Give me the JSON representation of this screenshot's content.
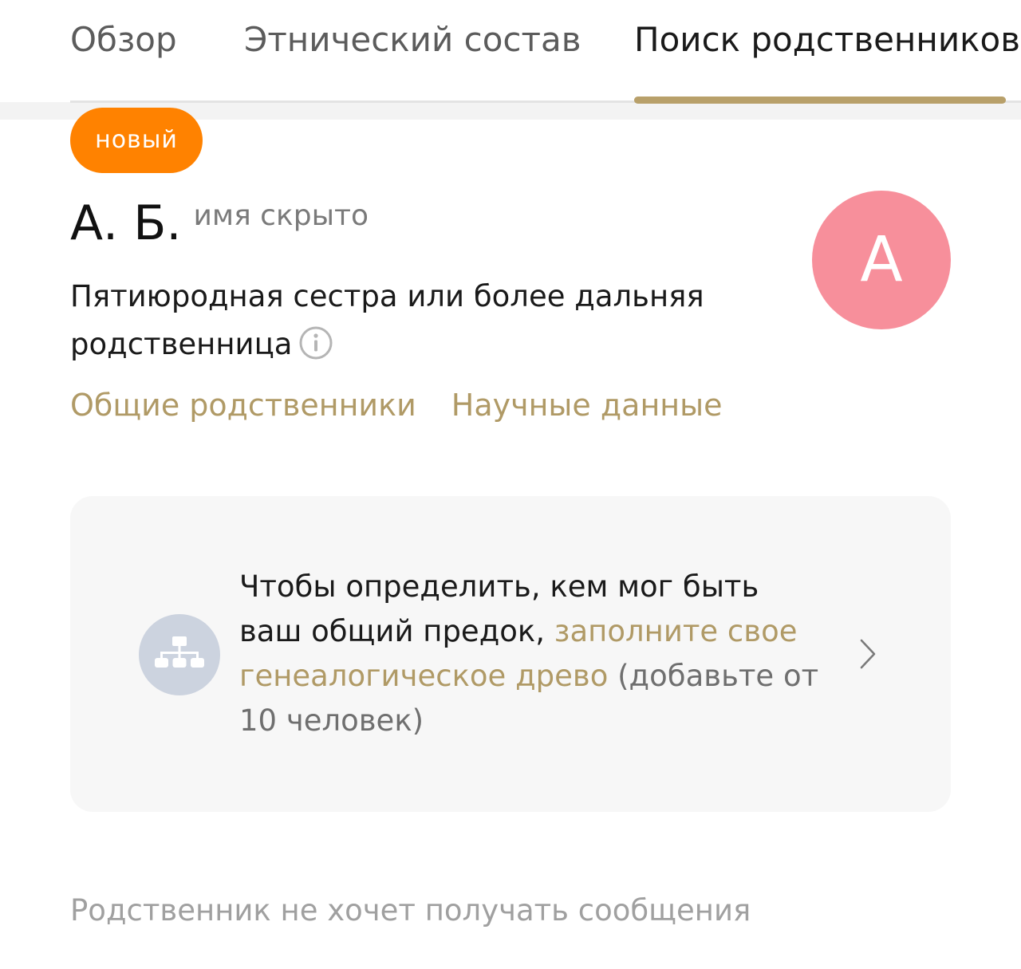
{
  "tabs": [
    {
      "label": "Обзор",
      "active": false
    },
    {
      "label": "Этнический состав",
      "active": false
    },
    {
      "label": "Поиск родственников",
      "active": true
    }
  ],
  "badge": {
    "label": "новый"
  },
  "match": {
    "initials": "А. Б.",
    "name_hidden": "имя скрыто",
    "relationship": "Пятиюродная сестра или более дальняя родственница",
    "avatar_letter": "А"
  },
  "links": {
    "shared_relatives": "Общие родственники",
    "science_data": "Научные данные"
  },
  "tree_card": {
    "text_start": "Чтобы определить, кем мог быть ваш общий предок, ",
    "link_text": "заполните свое генеалогическое древо",
    "text_end": " (добавьте от 10 человек)"
  },
  "footer": {
    "note": "Родственник не хочет получать сообщения"
  },
  "colors": {
    "accent_gold": "#b09a66",
    "badge_orange": "#ff8200",
    "avatar_pink": "#f78f9b",
    "tree_icon_bg": "#ccd3df"
  },
  "icons": {
    "info": "info-icon",
    "tree": "family-tree-icon",
    "chevron": "chevron-right-icon"
  }
}
